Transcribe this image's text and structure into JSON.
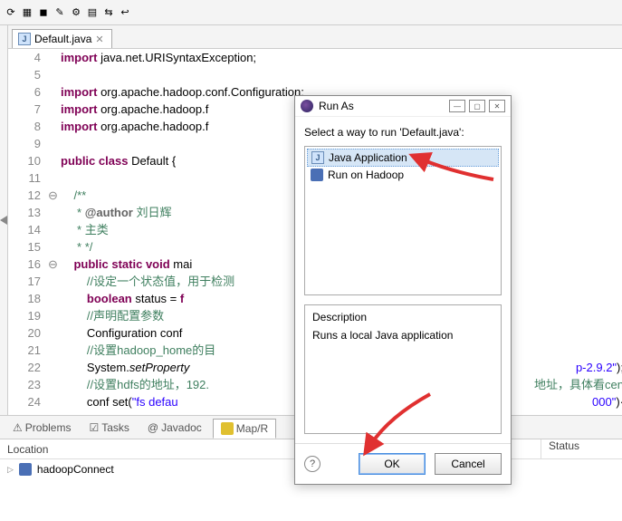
{
  "tab": {
    "label": "Default.java"
  },
  "code": {
    "lines": [
      {
        "n": 4,
        "fold": "",
        "html": "<span class='kw'>import</span> java.net.URISyntaxException;"
      },
      {
        "n": 5,
        "fold": "",
        "html": ""
      },
      {
        "n": 6,
        "fold": "",
        "html": "<span class='kw'>import</span> org.apache.hadoop.conf.Configuration;"
      },
      {
        "n": 7,
        "fold": "",
        "html": "<span class='kw'>import</span> org.apache.hadoop.f"
      },
      {
        "n": 8,
        "fold": "",
        "html": "<span class='kw'>import</span> org.apache.hadoop.f"
      },
      {
        "n": 9,
        "fold": "",
        "html": ""
      },
      {
        "n": 10,
        "fold": "",
        "html": "<span class='kw'>public</span> <span class='kw'>class</span> Default {"
      },
      {
        "n": 11,
        "fold": "",
        "html": ""
      },
      {
        "n": 12,
        "fold": "⊖",
        "html": "    <span class='cm'>/**</span>"
      },
      {
        "n": 13,
        "fold": "",
        "html": "<span class='cm'>     * <span class='tag'>@author</span> 刘日辉</span>"
      },
      {
        "n": 14,
        "fold": "",
        "html": "<span class='cm'>     * 主类</span>"
      },
      {
        "n": 15,
        "fold": "",
        "html": "<span class='cm'>     * */</span>"
      },
      {
        "n": 16,
        "fold": "⊖",
        "html": "    <span class='kw'>public</span> <span class='kw'>static</span> <span class='kw'>void</span> mai"
      },
      {
        "n": 17,
        "fold": "",
        "html": "        <span class='cm'>//设定一个状态值，用于检测</span>"
      },
      {
        "n": 18,
        "fold": "",
        "html": "        <span class='kw'>boolean</span> status = <span class='kw'>f</span>"
      },
      {
        "n": 19,
        "fold": "",
        "html": "        <span class='cm'>//声明配置参数</span>"
      },
      {
        "n": 20,
        "fold": "",
        "html": "        Configuration conf"
      },
      {
        "n": 21,
        "fold": "",
        "html": "        <span class='cm'>//设置hadoop_home的目</span>"
      },
      {
        "n": 22,
        "fold": "",
        "tail": "<span class='str'>p-2.9.2\"</span>);",
        "html": "        System.<span class='it'>setProperty</span>"
      },
      {
        "n": 23,
        "fold": "",
        "tail": "<span class='cm'>地址，具体看cen</span>",
        "html": "        <span class='cm'>//设置hdfs的地址，192.</span>"
      },
      {
        "n": 24,
        "fold": "",
        "tail": "<span class='str'>000\"</span>)·",
        "html": "        conf set(<span class='str'>\"fs defau</span>"
      }
    ]
  },
  "bottom": {
    "tabs": [
      "Problems",
      "Tasks",
      "Javadoc",
      "Map/R"
    ],
    "active": 3,
    "headers": {
      "location": "Location",
      "status": "Status"
    },
    "row": {
      "name": "hadoopConnect"
    }
  },
  "modal": {
    "title": "Run As",
    "prompt": "Select a way to run 'Default.java':",
    "items": [
      {
        "label": "Java Application",
        "icon": "java",
        "selected": true
      },
      {
        "label": "Run on Hadoop",
        "icon": "elephant",
        "selected": false
      }
    ],
    "descHeader": "Description",
    "descBody": "Runs a local Java application",
    "ok": "OK",
    "cancel": "Cancel"
  }
}
